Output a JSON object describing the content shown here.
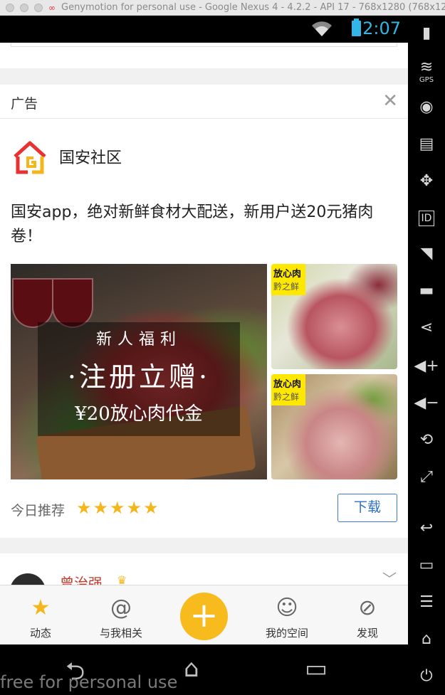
{
  "window": {
    "title": "Genymotion for personal use - Google Nexus 4 - 4.2.2 - API 17 - 768x1280 (768x12..."
  },
  "status_bar": {
    "time": "2:07",
    "icons": [
      "wifi-icon",
      "battery-icon"
    ]
  },
  "ad": {
    "label": "广告",
    "brand_name": "国安社区",
    "text": "国安app，绝对新鲜食材大配送，新用户送20元猪肉卷！",
    "banner": {
      "headline_small": "新人福利",
      "headline_big": "·注册立赠·",
      "headline_offer": "¥20放心肉代金",
      "side_tag_top": "放心肉",
      "side_tag_bottom": "黔之鲜"
    },
    "recommend_label": "今日推荐",
    "rating": 5,
    "stars": "★★★★★",
    "download_label": "下载"
  },
  "feed": {
    "first_post_name": "曾治强"
  },
  "bottom_nav": {
    "items": [
      {
        "label": "动态",
        "icon": "star-z-icon"
      },
      {
        "label": "与我相关",
        "icon": "at-icon"
      },
      {
        "label": "",
        "icon": "plus-icon"
      },
      {
        "label": "我的空间",
        "icon": "person-icon"
      },
      {
        "label": "发现",
        "icon": "compass-icon"
      }
    ],
    "fab_symbol": "+"
  },
  "toolbar": {
    "gps_label": "GPS",
    "id_label": "ID"
  },
  "watermark": "free for personal use",
  "colors": {
    "accent": "#f8bb1d",
    "link_blue": "#2d6fc5",
    "status_blue": "#33b5e5",
    "name_red": "#c0392b"
  }
}
